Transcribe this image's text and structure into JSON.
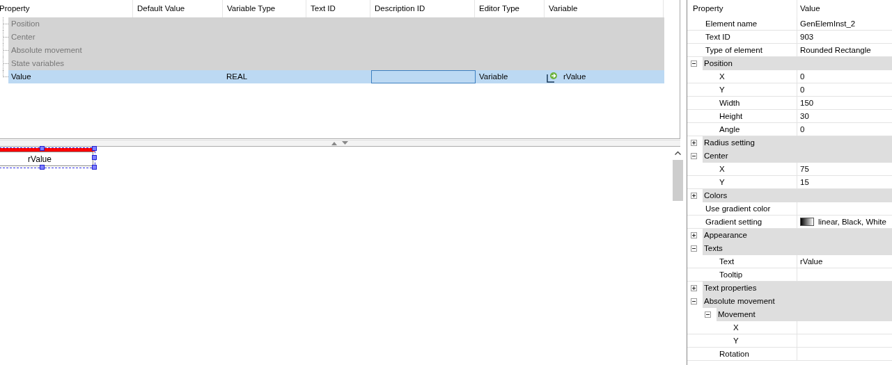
{
  "table": {
    "columns": [
      "Property",
      "Default Value",
      "Variable Type",
      "Text ID",
      "Description ID",
      "Editor Type",
      "Variable"
    ],
    "rows": [
      {
        "kind": "category",
        "selected": false,
        "cells": [
          "Position"
        ]
      },
      {
        "kind": "category",
        "selected": false,
        "cells": [
          "Center"
        ]
      },
      {
        "kind": "category",
        "selected": false,
        "cells": [
          "Absolute movement"
        ]
      },
      {
        "kind": "category",
        "selected": false,
        "cells": [
          "State variables"
        ]
      },
      {
        "kind": "value",
        "selected": true,
        "editing": true,
        "cells": [
          "Value",
          null,
          "REAL",
          null,
          null,
          "Variable",
          "rValue"
        ]
      }
    ]
  },
  "canvas": {
    "element": {
      "text": "rValue",
      "selected": true
    }
  },
  "properties": {
    "columns": [
      "Property",
      "Value"
    ],
    "items": [
      {
        "kind": "property",
        "name": "Element name",
        "value": "GenElemInst_2"
      },
      {
        "kind": "property",
        "name": "Text ID",
        "value": "903"
      },
      {
        "kind": "property",
        "name": "Type of element",
        "value": "Rounded Rectangle"
      },
      {
        "kind": "group",
        "name": "Position",
        "expanded": true,
        "children": [
          {
            "kind": "property",
            "name": "X",
            "value": "0"
          },
          {
            "kind": "property",
            "name": "Y",
            "value": "0"
          },
          {
            "kind": "property",
            "name": "Width",
            "value": "150"
          },
          {
            "kind": "property",
            "name": "Height",
            "value": "30"
          },
          {
            "kind": "property",
            "name": "Angle",
            "value": "0"
          }
        ]
      },
      {
        "kind": "group",
        "name": "Radius setting",
        "expanded": false
      },
      {
        "kind": "group",
        "name": "Center",
        "expanded": true,
        "children": [
          {
            "kind": "property",
            "name": "X",
            "value": "75"
          },
          {
            "kind": "property",
            "name": "Y",
            "value": "15"
          }
        ]
      },
      {
        "kind": "group",
        "name": "Colors",
        "expanded": false
      },
      {
        "kind": "property",
        "name": "Use gradient color"
      },
      {
        "kind": "gradient",
        "name": "Gradient setting",
        "value": "linear, Black, White"
      },
      {
        "kind": "group",
        "name": "Appearance",
        "expanded": false
      },
      {
        "kind": "group",
        "name": "Texts",
        "expanded": true,
        "children": [
          {
            "kind": "property",
            "name": "Text",
            "value": "rValue"
          },
          {
            "kind": "property",
            "name": "Tooltip"
          }
        ]
      },
      {
        "kind": "group",
        "name": "Text properties",
        "expanded": false
      },
      {
        "kind": "group",
        "name": "Absolute movement",
        "expanded": true,
        "children": [
          {
            "kind": "group",
            "name": "Movement",
            "expanded": true,
            "children": [
              {
                "kind": "property",
                "name": "X"
              },
              {
                "kind": "property",
                "name": "Y"
              }
            ]
          },
          {
            "kind": "property",
            "name": "Rotation"
          }
        ]
      }
    ]
  }
}
